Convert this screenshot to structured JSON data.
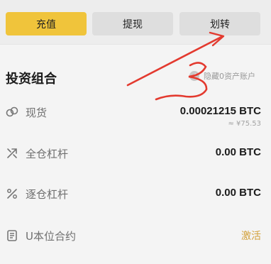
{
  "actions": {
    "deposit_label": "充值",
    "withdraw_label": "提现",
    "transfer_label": "划转"
  },
  "portfolio": {
    "title": "投资组合",
    "hide_zero_label": "隐藏0资产账户"
  },
  "accounts": [
    {
      "name": "现货",
      "value": "0.00021215 BTC",
      "subvalue": "≈ ¥75.53",
      "icon": "spot-icon"
    },
    {
      "name": "全仓杠杆",
      "value": "0.00 BTC",
      "icon": "cross-margin-icon"
    },
    {
      "name": "逐仓杠杆",
      "value": "0.00 BTC",
      "icon": "isolated-margin-icon"
    },
    {
      "name": "U本位合约",
      "action": "激活",
      "icon": "usdm-futures-icon"
    }
  ],
  "annotation": {
    "number": "3",
    "color": "#e33a2f"
  }
}
